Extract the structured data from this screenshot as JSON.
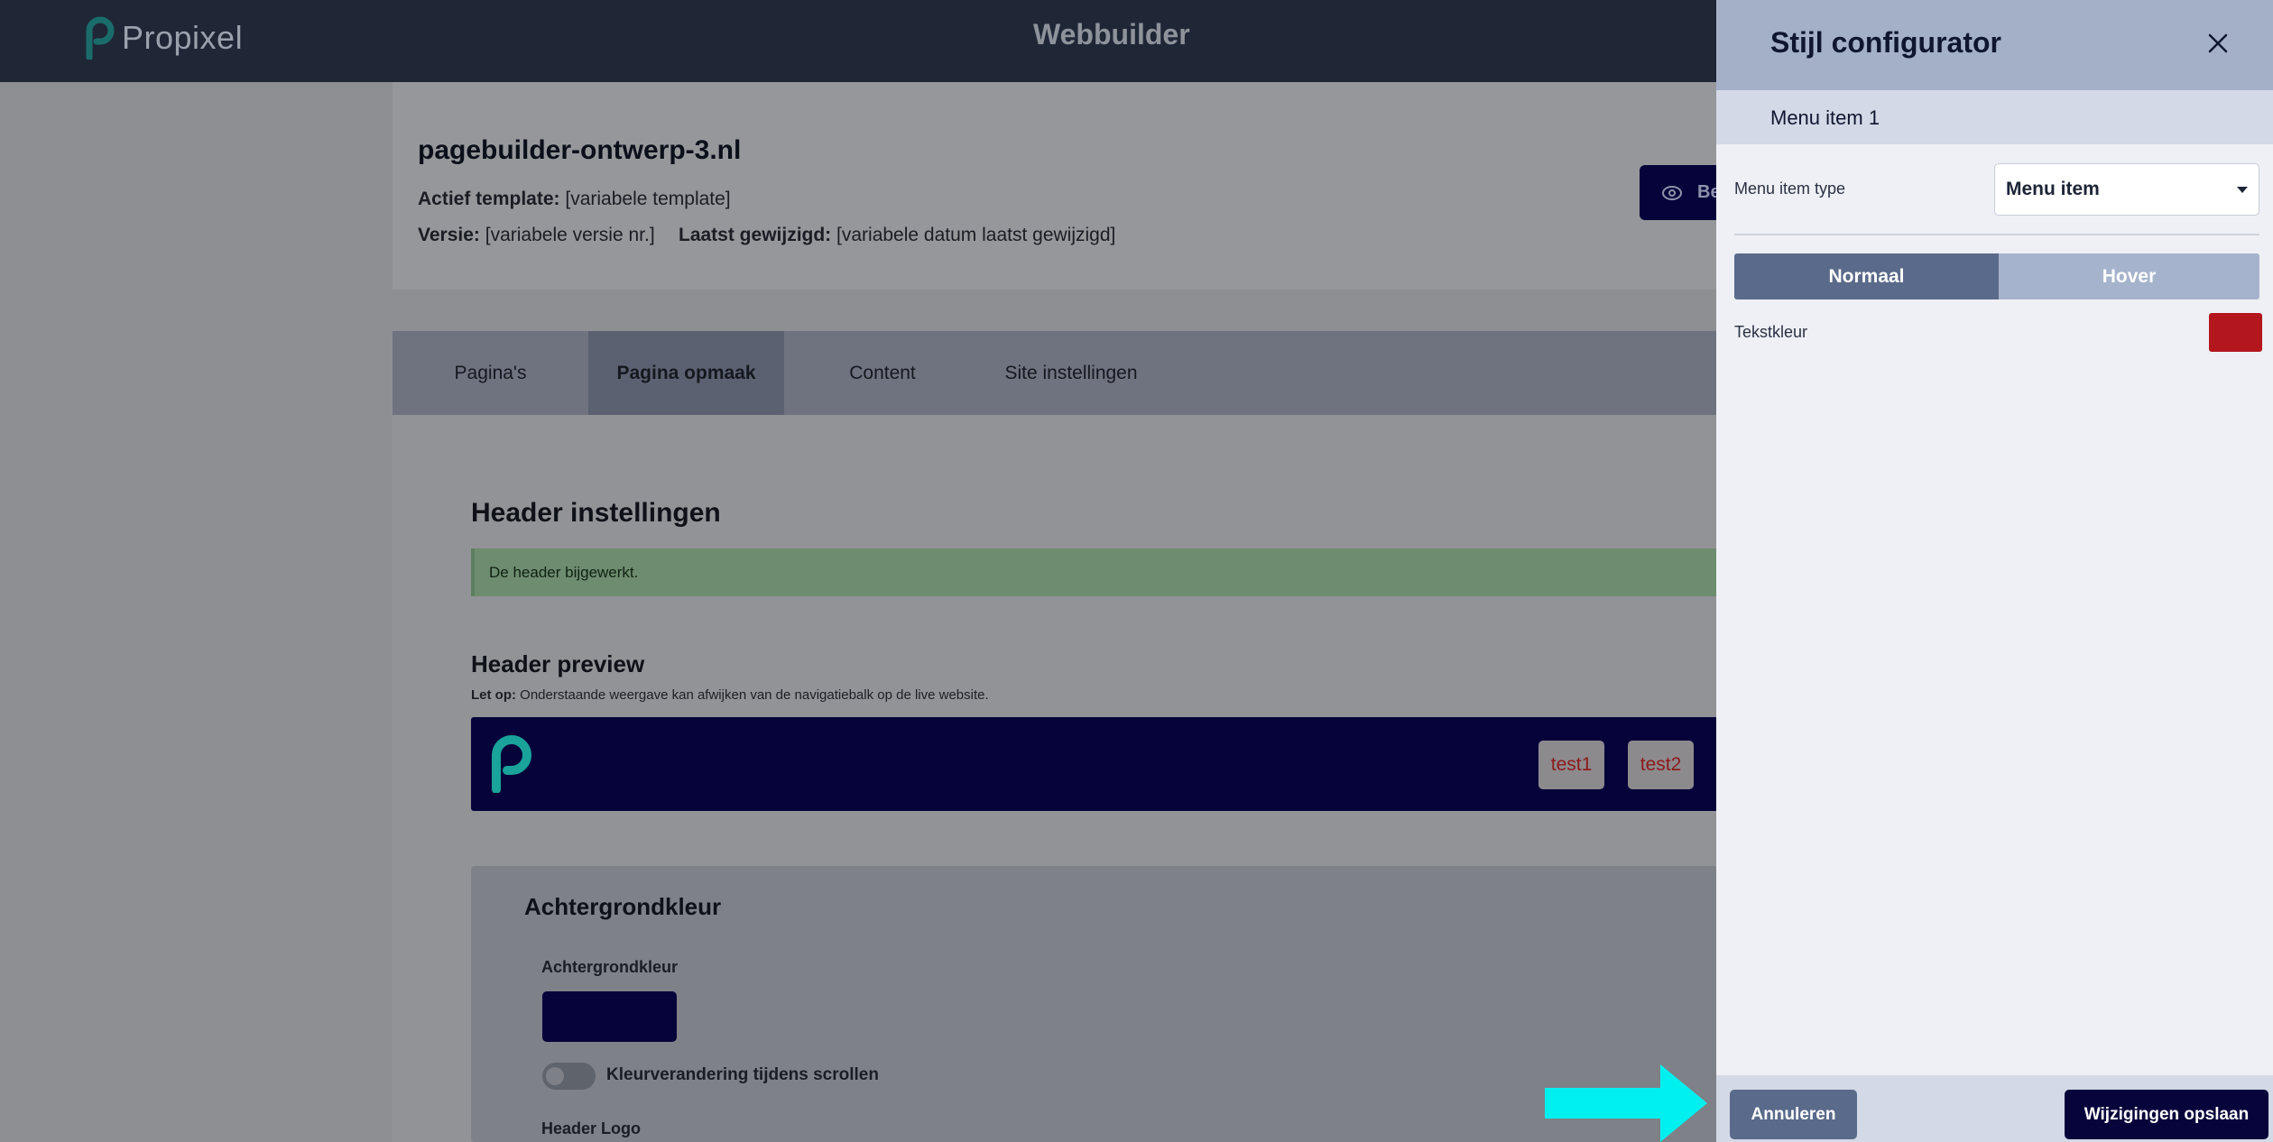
{
  "topbar": {
    "logo_text": "Propixel",
    "title": "Webbuilder"
  },
  "site": {
    "name": "pagebuilder-ontwerp-3.nl",
    "template_label": "Actief template:",
    "template_value": "[variabele template]",
    "version_label": "Versie:",
    "version_value": "[variabele versie nr.]",
    "modified_label": "Laatst gewijzigd:",
    "modified_value": "[variabele datum laatst gewijzigd]",
    "preview_button": "Be"
  },
  "tabs": [
    {
      "label": "Pagina's"
    },
    {
      "label": "Pagina opmaak"
    },
    {
      "label": "Content"
    },
    {
      "label": "Site instellingen"
    }
  ],
  "header_settings": {
    "title": "Header instellingen",
    "alert": "De header bijgewerkt.",
    "preview_title": "Header preview",
    "note_label": "Let op:",
    "note_text": "Onderstaande weergave kan afwijken van de navigatiebalk op de live website.",
    "preview_items": [
      "test1",
      "test2"
    ]
  },
  "background": {
    "card_title": "Achtergrondkleur",
    "field_label": "Achtergrondkleur",
    "color": "#06033a",
    "toggle_label": "Kleurverandering tijdens scrollen",
    "logo_label": "Header Logo"
  },
  "panel": {
    "title": "Stijl configurator",
    "subtitle": "Menu item 1",
    "type_label": "Menu item type",
    "type_value": "Menu item",
    "segments": {
      "normal": "Normaal",
      "hover": "Hover"
    },
    "text_color_label": "Tekstkleur",
    "text_color": "#b3161c",
    "cancel": "Annuleren",
    "save": "Wijzigingen opslaan"
  },
  "colors": {
    "topbar": "#1f2737",
    "navy": "#06033a",
    "accent_teal": "#1aa39a",
    "arrow": "#00f0f0"
  }
}
